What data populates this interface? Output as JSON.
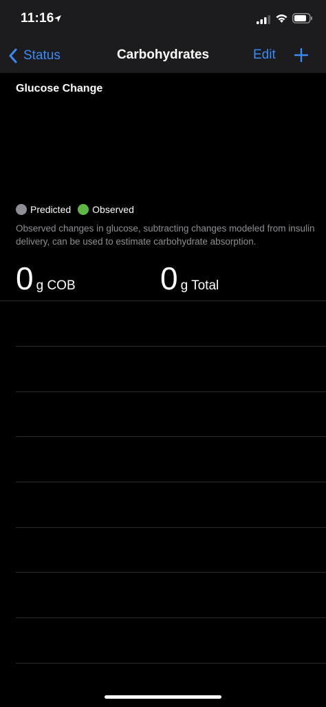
{
  "status_bar": {
    "time": "11:16",
    "icons": [
      "location-arrow-icon",
      "cellular-signal-icon",
      "wifi-icon",
      "battery-icon"
    ]
  },
  "nav": {
    "back_label": "Status",
    "title": "Carbohydrates",
    "edit_label": "Edit",
    "add_icon": "plus-icon"
  },
  "chart": {
    "title": "Glucose Change",
    "legend": [
      {
        "label": "Predicted",
        "color": "#8e8e93"
      },
      {
        "label": "Observed",
        "color": "#5db844"
      }
    ],
    "description": "Observed changes in glucose, subtracting changes modeled from insulin delivery, can be used to estimate carbohydrate absorption."
  },
  "stats": {
    "cob_value": "0",
    "cob_unit": "g COB",
    "total_value": "0",
    "total_unit": "g Total"
  },
  "colors": {
    "accent": "#3b8bf6",
    "background": "#000000",
    "bar_background": "#1c1c1e",
    "separator": "#2c2c2e",
    "secondary_text": "#8e8e93"
  }
}
